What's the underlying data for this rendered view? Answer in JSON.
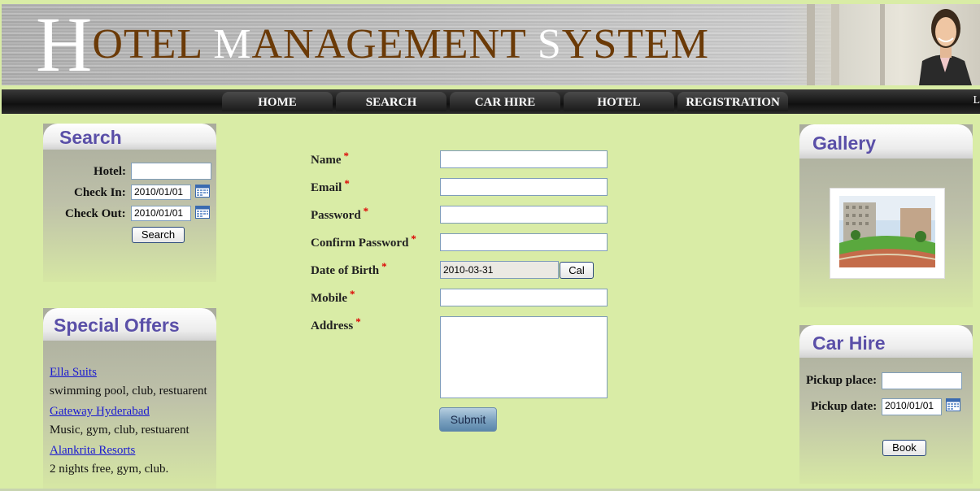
{
  "banner": {
    "title_first_letter": "H",
    "title_rest_a": "OTEL ",
    "title_rest_b": "M",
    "title_rest_c": "ANAGEMENT ",
    "title_rest_d": "S",
    "title_rest_e": "YSTEM"
  },
  "nav": {
    "items": [
      "HOME",
      "SEARCH",
      "CAR HIRE",
      "HOTEL",
      "REGISTRATION"
    ],
    "edge_text": "L"
  },
  "search_panel": {
    "heading": "Search",
    "hotel_label": "Hotel:",
    "hotel_value": "",
    "checkin_label": "Check In:",
    "checkin_value": "2010/01/01",
    "checkout_label": "Check Out:",
    "checkout_value": "2010/01/01",
    "button": "Search"
  },
  "offers_panel": {
    "heading": "Special Offers",
    "items": [
      {
        "name": "Ella Suits",
        "desc": "swimming pool, club, restuarent"
      },
      {
        "name": "Gateway Hyderabad",
        "desc": "Music, gym, club, restuarent"
      },
      {
        "name": "Alankrita Resorts",
        "desc": "2 nights free, gym, club."
      }
    ]
  },
  "form": {
    "name_label": "Name",
    "email_label": "Email",
    "password_label": "Password",
    "confirm_label": "Confirm Password",
    "dob_label": "Date of Birth",
    "dob_value": "2010-03-31",
    "cal_button": "Cal",
    "mobile_label": "Mobile",
    "address_label": "Address",
    "required_mark": "*",
    "submit": "Submit"
  },
  "gallery_panel": {
    "heading": "Gallery"
  },
  "carhire_panel": {
    "heading": "Car Hire",
    "pickup_place_label": "Pickup place:",
    "pickup_place_value": "",
    "pickup_date_label": "Pickup date:",
    "pickup_date_value": "2010/01/01",
    "button": "Book"
  },
  "colors": {
    "page_bg": "#d9eca6",
    "title_brown": "#6b3a07",
    "panel_heading": "#5a4fa8",
    "required": "#dd0000",
    "link": "#1a1ad0"
  }
}
